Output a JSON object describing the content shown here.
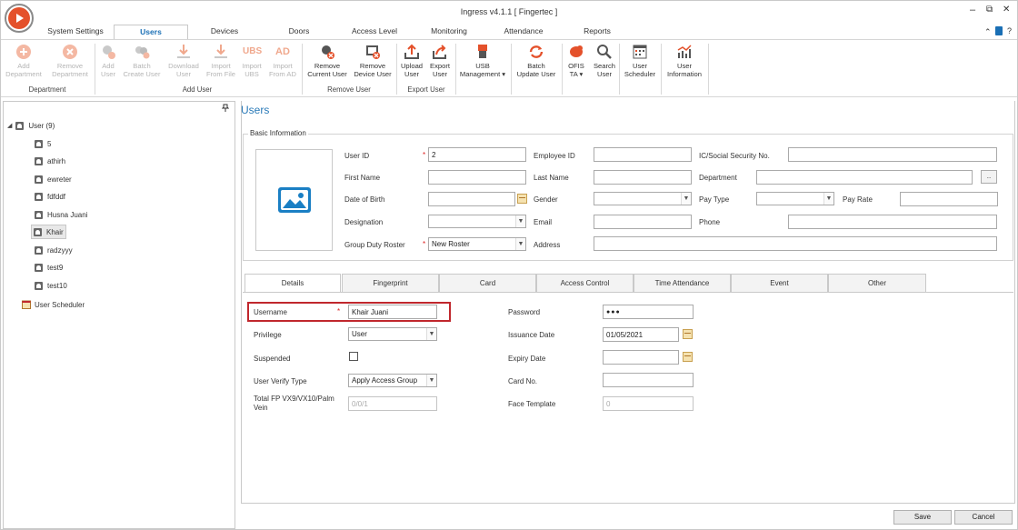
{
  "window": {
    "title": "Ingress v4.1.1 [ Fingertec ]",
    "minimize": "–",
    "restore": "⧉",
    "close": "✕"
  },
  "menu_tabs": [
    "System Settings",
    "Users",
    "Devices",
    "Doors",
    "Access Level",
    "Monitoring",
    "Attendance",
    "Reports"
  ],
  "menu_right": {
    "collapse": "⌃",
    "help": "?"
  },
  "ribbon": {
    "buttons": [
      {
        "label": "Add\nDepartment",
        "icon": "add-icon",
        "enabled": false
      },
      {
        "label": "Remove\nDepartment",
        "icon": "remove-icon",
        "enabled": false
      },
      {
        "label": "Add\nUser",
        "icon": "add-user-icon",
        "enabled": false
      },
      {
        "label": "Batch\nCreate User",
        "icon": "batch-user-icon",
        "enabled": false
      },
      {
        "label": "Download\nUser",
        "icon": "download-icon",
        "enabled": false
      },
      {
        "label": "Import\nFrom File",
        "icon": "import-icon",
        "enabled": false
      },
      {
        "label": "Import\nUBS",
        "icon": "ubs-icon",
        "enabled": false
      },
      {
        "label": "Import\nFrom AD",
        "icon": "ad-icon",
        "enabled": false
      },
      {
        "label": "Remove\nCurrent User",
        "icon": "remove-user-icon",
        "enabled": true
      },
      {
        "label": "Remove\nDevice User",
        "icon": "remove-device-user-icon",
        "enabled": true
      },
      {
        "label": "Upload\nUser",
        "icon": "upload-icon",
        "enabled": true
      },
      {
        "label": "Export\nUser",
        "icon": "export-icon",
        "enabled": true
      },
      {
        "label": "USB\nManagement ▾",
        "icon": "usb-icon",
        "enabled": true
      },
      {
        "label": "Batch\nUpdate User",
        "icon": "refresh-icon",
        "enabled": true
      },
      {
        "label": "OFIS\nTA ▾",
        "icon": "ofis-icon",
        "enabled": true
      },
      {
        "label": "Search\nUser",
        "icon": "search-icon",
        "enabled": true
      },
      {
        "label": "User\nScheduler",
        "icon": "scheduler-icon",
        "enabled": true
      },
      {
        "label": "User\nInformation",
        "icon": "chart-icon",
        "enabled": true
      }
    ],
    "icon_texts": {
      "ubs": "UBS",
      "ad": "AD"
    },
    "groups": [
      "Department",
      "Add User",
      "Remove User",
      "Export User"
    ]
  },
  "tree": {
    "pin": "📌",
    "root": "User (9)",
    "users": [
      "5",
      "athirh",
      "ewreter",
      "fdfddf",
      "Husna Juani",
      "Khair",
      "radzyyy",
      "test9",
      "test10"
    ],
    "selected": "Khair",
    "scheduler": "User Scheduler",
    "expander": "◢"
  },
  "page": {
    "title": "Users",
    "section": "Basic Information"
  },
  "basic": {
    "user_id_label": "User ID",
    "user_id_value": "2",
    "employee_id_label": "Employee ID",
    "ic_label": "IC/Social Security No.",
    "first_name_label": "First Name",
    "last_name_label": "Last Name",
    "department_label": "Department",
    "dept_button": "..",
    "dob_label": "Date of Birth",
    "gender_label": "Gender",
    "pay_type_label": "Pay Type",
    "pay_rate_label": "Pay Rate",
    "designation_label": "Designation",
    "email_label": "Email",
    "phone_label": "Phone",
    "roster_label": "Group Duty Roster",
    "roster_value": "New Roster",
    "address_label": "Address",
    "required_mark": "*"
  },
  "detail_tabs": [
    "Details",
    "Fingerprint",
    "Card",
    "Access Control",
    "Time Attendance",
    "Event",
    "Other"
  ],
  "details": {
    "username_label": "Username",
    "username_value": "Khair Juani",
    "password_label": "Password",
    "password_value": "●●●",
    "privilege_label": "Privilege",
    "privilege_value": "User",
    "issuance_label": "Issuance Date",
    "issuance_value": "01/05/2021",
    "suspended_label": "Suspended",
    "expiry_label": "Expiry Date",
    "verify_label": "User Verify Type",
    "verify_value": "Apply Access Group",
    "card_label": "Card No.",
    "total_fp_label": "Total FP VX9/VX10/Palm Vein",
    "total_fp_value": "0/0/1",
    "face_label": "Face Template",
    "face_value": "0"
  },
  "footer": {
    "save": "Save",
    "cancel": "Cancel"
  },
  "colors": {
    "accent": "#1a6fb5",
    "highlight": "#c0272d",
    "logo": "#e4512b"
  }
}
